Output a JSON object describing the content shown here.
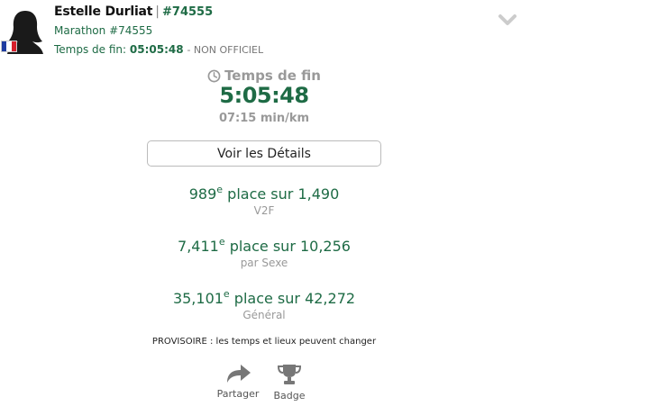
{
  "runner": {
    "name": "Estelle Durliat",
    "separator": "|",
    "bib": "#74555",
    "race": "Marathon #74555",
    "finish_label": "Temps de fin:",
    "finish_time": "05:05:48",
    "official_status": "- NON OFFICIEL",
    "flag_colors": [
      "#1f3ca0",
      "#ffffff",
      "#d61f2b"
    ]
  },
  "finish": {
    "heading": "Temps de fin",
    "time": "5:05:48",
    "pace": "07:15 min/km"
  },
  "details_button": "Voir les Détails",
  "placements": [
    {
      "rank": "989",
      "suffix": "e",
      "text": "place sur 1,490",
      "category": "V2F"
    },
    {
      "rank": "7,411",
      "suffix": "e",
      "text": "place sur 10,256",
      "category": "par Sexe"
    },
    {
      "rank": "35,101",
      "suffix": "e",
      "text": "place sur 42,272",
      "category": "Général"
    }
  ],
  "note": "PROVISOIRE : les temps et lieux peuvent changer",
  "actions": {
    "share": "Partager",
    "badge": "Badge"
  },
  "icons": {
    "avatar": "person-silhouette-icon",
    "flag": "france-flag-icon",
    "chevron": "chevron-down-icon",
    "clock": "clock-icon",
    "share": "share-arrow-icon",
    "badge": "trophy-icon"
  },
  "colors": {
    "accent_green": "#1e6b45",
    "muted_gray": "#999999"
  }
}
